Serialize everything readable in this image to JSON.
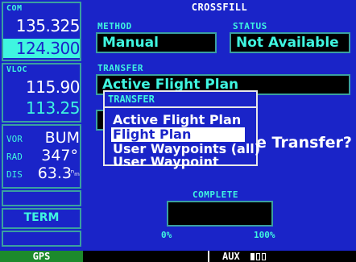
{
  "com": {
    "label": "COM",
    "active": "135.325",
    "standby": "124.300"
  },
  "vloc": {
    "label": "VLOC",
    "active": "115.90",
    "standby": "113.25"
  },
  "vor": {
    "id_label": "VOR",
    "id_value": "BUM",
    "rad_label": "RAD",
    "rad_value": "347°",
    "dis_label": "DIS",
    "dis_value": "63.3",
    "dis_unit": "ⁿₘ"
  },
  "softkey": {
    "label": "TERM"
  },
  "page": {
    "title": "CROSSFILL",
    "method_label": "METHOD",
    "method_value": "Manual",
    "status_label": "STATUS",
    "status_value": "Not Available",
    "transfer_label": "TRANSFER",
    "transfer_value": "Active Flight Plan",
    "prompt_tail": "e Transfer?",
    "complete_label": "COMPLETE",
    "complete_fraction": 0,
    "pct_min": "0%",
    "pct_max": "100%"
  },
  "popup": {
    "title": "TRANSFER",
    "items": [
      "Active Flight Plan",
      "Flight Plan",
      "User Waypoints (all)",
      "User Waypoint"
    ],
    "selected_index": 1
  },
  "statusbar": {
    "mode": "GPS",
    "group": "AUX",
    "pages_total": 3,
    "page_active": 1
  },
  "colors": {
    "background": "#1a24c8",
    "accent": "#3ff5e0",
    "gps": "#1c8a2c",
    "border": "#3aa0a0"
  }
}
